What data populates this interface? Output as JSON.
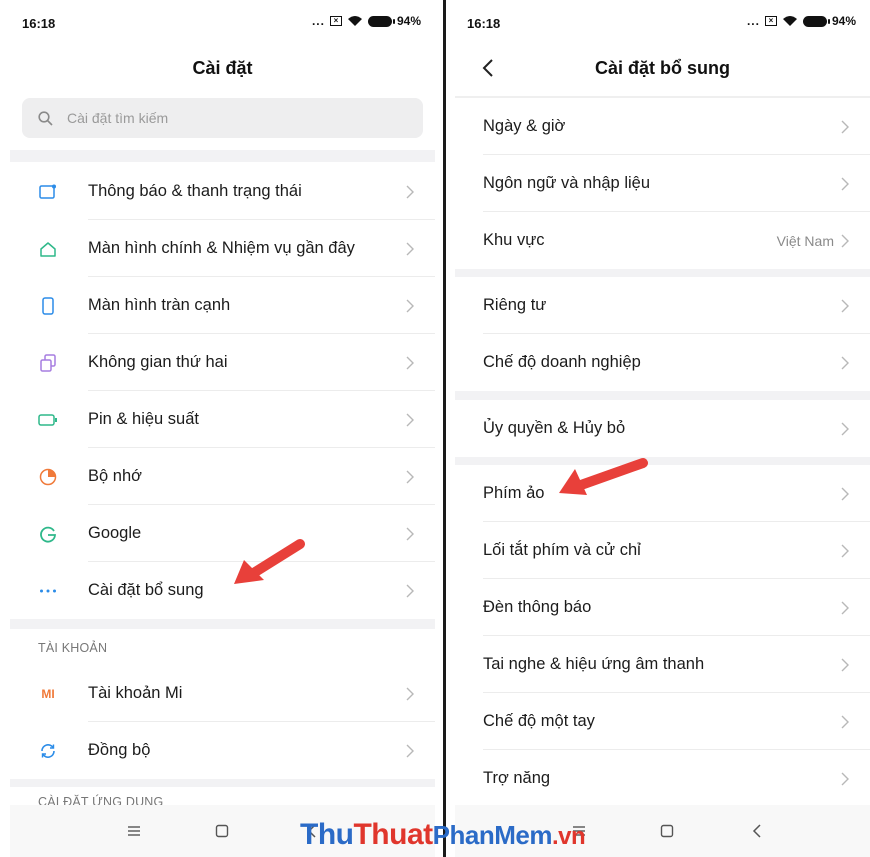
{
  "left": {
    "status": {
      "time": "16:18",
      "dots": "...",
      "battery": "94%"
    },
    "title": "Cài đặt",
    "search": {
      "placeholder": "Cài đặt tìm kiếm"
    },
    "items": [
      {
        "label": "Thông báo & thanh trạng thái",
        "icon": "notification-icon"
      },
      {
        "label": "Màn hình chính & Nhiệm vụ gần đây",
        "icon": "home-icon"
      },
      {
        "label": "Màn hình tràn cạnh",
        "icon": "phone-icon"
      },
      {
        "label": "Không gian thứ hai",
        "icon": "second-space-icon"
      },
      {
        "label": "Pin & hiệu suất",
        "icon": "battery-icon"
      },
      {
        "label": "Bộ nhớ",
        "icon": "storage-icon"
      },
      {
        "label": "Google",
        "icon": "google-icon"
      },
      {
        "label": "Cài đặt bổ sung",
        "icon": "more-icon"
      }
    ],
    "section_accounts": "TÀI KHOẢN",
    "accounts": [
      {
        "label": "Tài khoản Mi",
        "icon": "mi-icon",
        "icon_text": "MI"
      },
      {
        "label": "Đồng bộ",
        "icon": "sync-icon"
      }
    ],
    "section_apps": "CÀI ĐẶT ỨNG DỤNG"
  },
  "right": {
    "status": {
      "time": "16:18",
      "dots": "...",
      "battery": "94%"
    },
    "title": "Cài đặt bổ sung",
    "groups": [
      [
        {
          "label": "Ngày & giờ"
        },
        {
          "label": "Ngôn ngữ và nhập liệu"
        },
        {
          "label": "Khu vực",
          "value": "Việt Nam"
        }
      ],
      [
        {
          "label": "Riêng tư"
        },
        {
          "label": "Chế độ doanh nghiệp"
        }
      ],
      [
        {
          "label": "Ủy quyền & Hủy bỏ"
        }
      ],
      [
        {
          "label": "Phím ảo"
        },
        {
          "label": "Lối tắt phím và cử chỉ"
        },
        {
          "label": "Đèn thông báo"
        },
        {
          "label": "Tai nghe & hiệu ứng âm thanh"
        },
        {
          "label": "Chế độ một tay"
        },
        {
          "label": "Trợ năng"
        }
      ]
    ]
  },
  "watermark": {
    "part1": "Thu",
    "part2": "Thuat",
    "part3": "PhanMem",
    "part4": ".vn"
  },
  "colors": {
    "accent_blue": "#2b8ce8",
    "arrow_red": "#e8403a",
    "icon_orange": "#f07a3a",
    "icon_purple": "#a67de0",
    "icon_green": "#2eb88a"
  }
}
